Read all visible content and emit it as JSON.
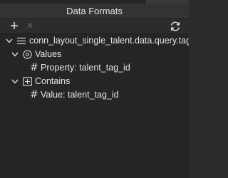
{
  "window": {
    "title": "Data Formats"
  },
  "toolbar": {
    "add_label": "+",
    "remove_label": "×",
    "refresh_icon": "refresh-icon"
  },
  "tree": {
    "root": {
      "icon": "list-icon",
      "label": "conn_layout_single_talent.data.query.tags",
      "expanded": true
    },
    "values": {
      "icon": "circle-target-icon",
      "label": "Values",
      "expanded": true,
      "child": {
        "icon": "hash-icon",
        "label": "Property: talent_tag_id"
      }
    },
    "contains": {
      "icon": "plus-box-icon",
      "label": "Contains",
      "expanded": true,
      "child": {
        "icon": "hash-icon",
        "label": "Value: talent_tag_id"
      }
    }
  },
  "colors": {
    "panel_bg": "#252525",
    "titlebar_bg": "#333333",
    "text": "#e6e6e6",
    "disabled": "#666666"
  }
}
